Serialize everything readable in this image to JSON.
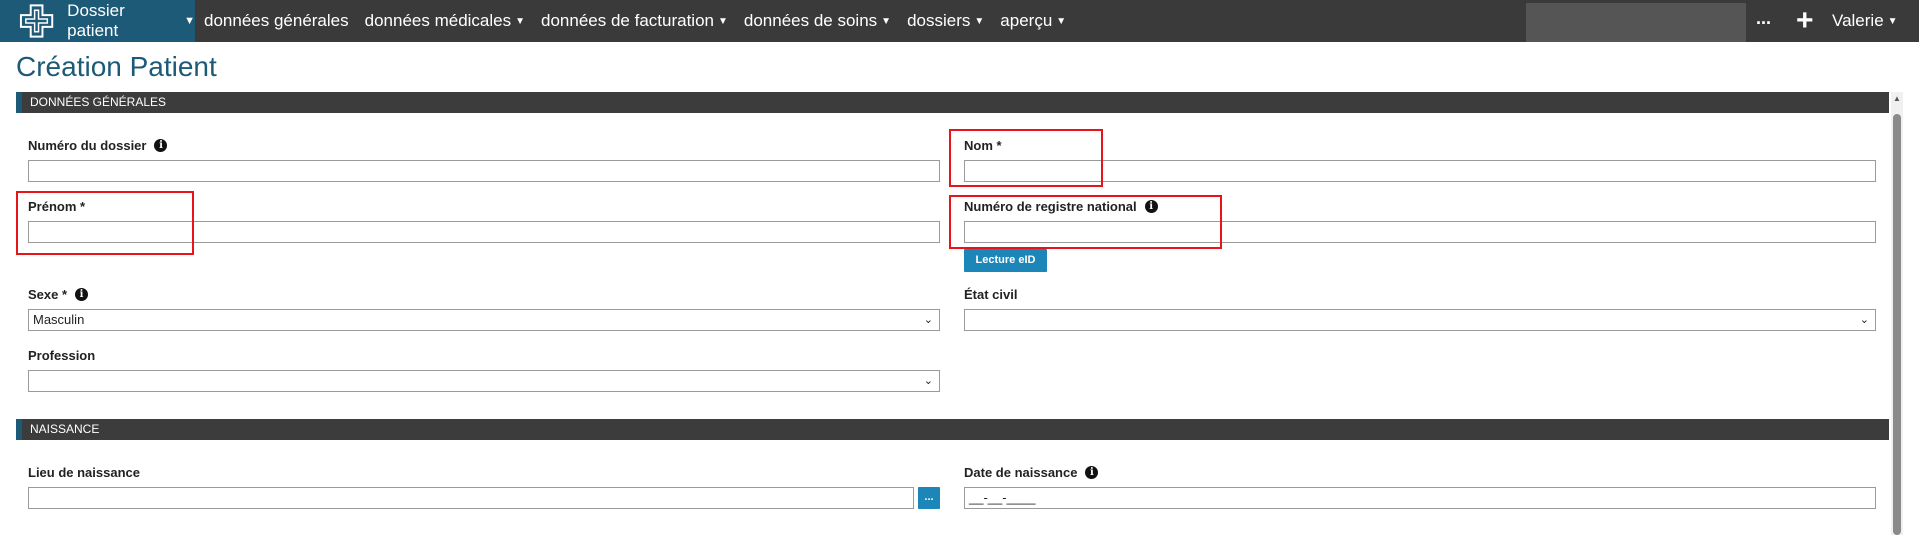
{
  "nav": {
    "brand": "Dossier patient",
    "items": [
      {
        "label": "données générales",
        "caret": false
      },
      {
        "label": "données médicales",
        "caret": true
      },
      {
        "label": "données de facturation",
        "caret": true
      },
      {
        "label": "données de soins",
        "caret": true
      },
      {
        "label": "dossiers",
        "caret": true
      },
      {
        "label": "aperçu",
        "caret": true
      }
    ],
    "more": "...",
    "add": "+",
    "user": "Valerie"
  },
  "page": {
    "title": "Création Patient"
  },
  "sections": {
    "general": "DONNÉES GÉNÉRALES",
    "birth": "NAISSANCE"
  },
  "form": {
    "file_number": {
      "label": "Numéro du dossier",
      "value": ""
    },
    "last_name": {
      "label": "Nom *",
      "value": ""
    },
    "first_name": {
      "label": "Prénom *",
      "value": ""
    },
    "national_register": {
      "label": "Numéro de registre national",
      "value": ""
    },
    "eid_button": "Lecture eID",
    "sex": {
      "label": "Sexe *",
      "value": "Masculin"
    },
    "civil_status": {
      "label": "État civil",
      "value": ""
    },
    "profession": {
      "label": "Profession",
      "value": ""
    },
    "birth_place": {
      "label": "Lieu de naissance",
      "value": "",
      "button": "..."
    },
    "birth_date": {
      "label": "Date de naissance",
      "value": "__-__-____"
    }
  },
  "icons": {
    "brand": "medical-cross-logo",
    "info": "info-icon",
    "caret": "chevron-down-icon"
  },
  "colors": {
    "brand": "#1c5a78",
    "topbar": "#3a3a3a",
    "highlight": "#e8141c",
    "button": "#1c86b8"
  }
}
